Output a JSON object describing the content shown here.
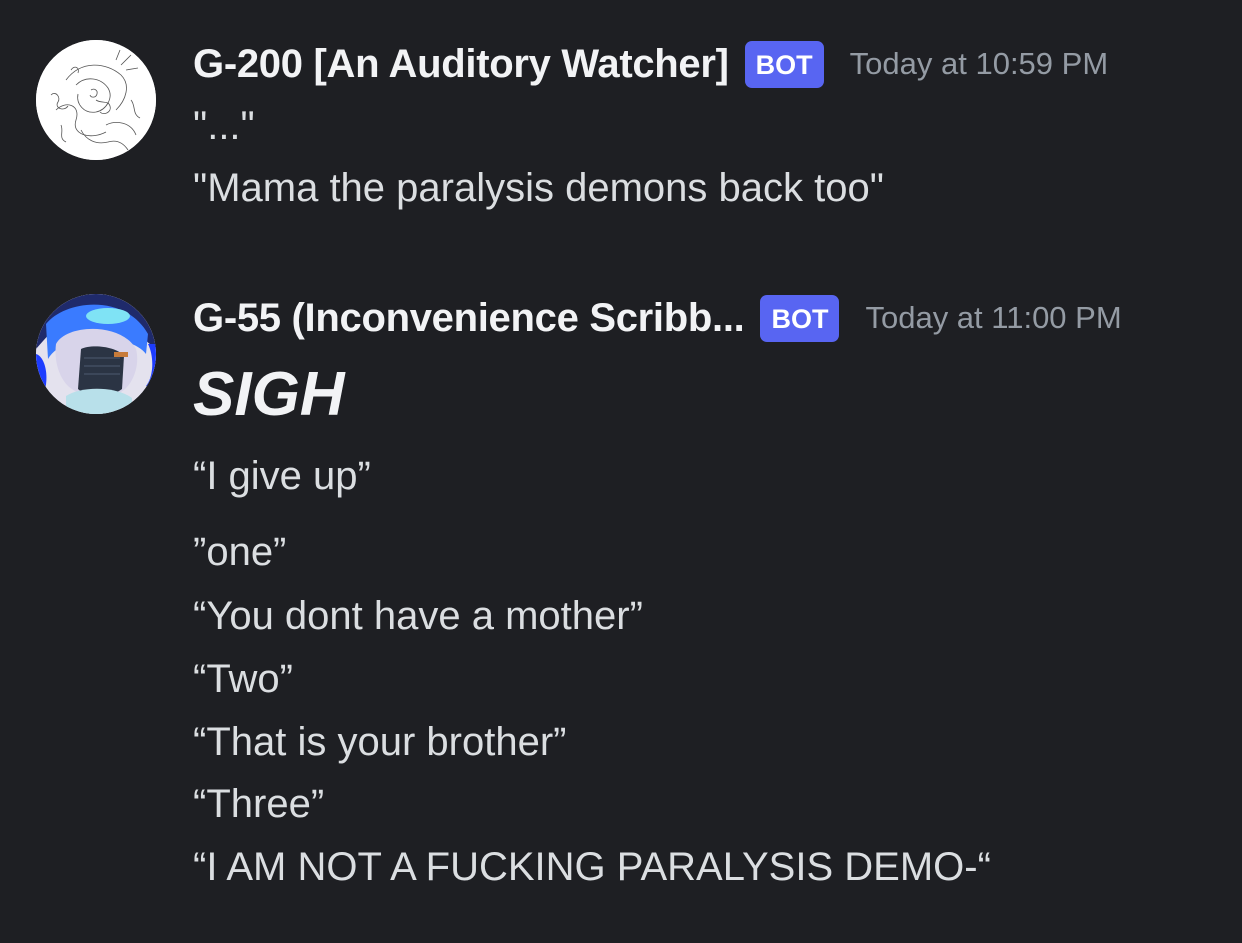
{
  "messages": [
    {
      "username": "G-200 [An Auditory Watcher]",
      "badge": "BOT",
      "timestamp": "Today at 10:59 PM",
      "lines": [
        "\"...\"",
        "\"Mama the paralysis demons back too\""
      ]
    },
    {
      "username": "G-55 (Inconvenience Scribb...",
      "badge": "BOT",
      "timestamp": "Today at 11:00 PM",
      "heading": "SIGH",
      "lines": [
        "“I give up”",
        "”one”",
        "“You dont have a mother”",
        "“Two”",
        "“That is your brother”",
        "“Three”",
        "“I AM NOT A FUCKING PARALYSIS DEMO-“"
      ]
    }
  ],
  "colors": {
    "background": "#1e1f23",
    "badge": "#5865f2",
    "username": "#f2f3f5",
    "text": "#dbdee1",
    "timestamp": "#949ba4"
  }
}
